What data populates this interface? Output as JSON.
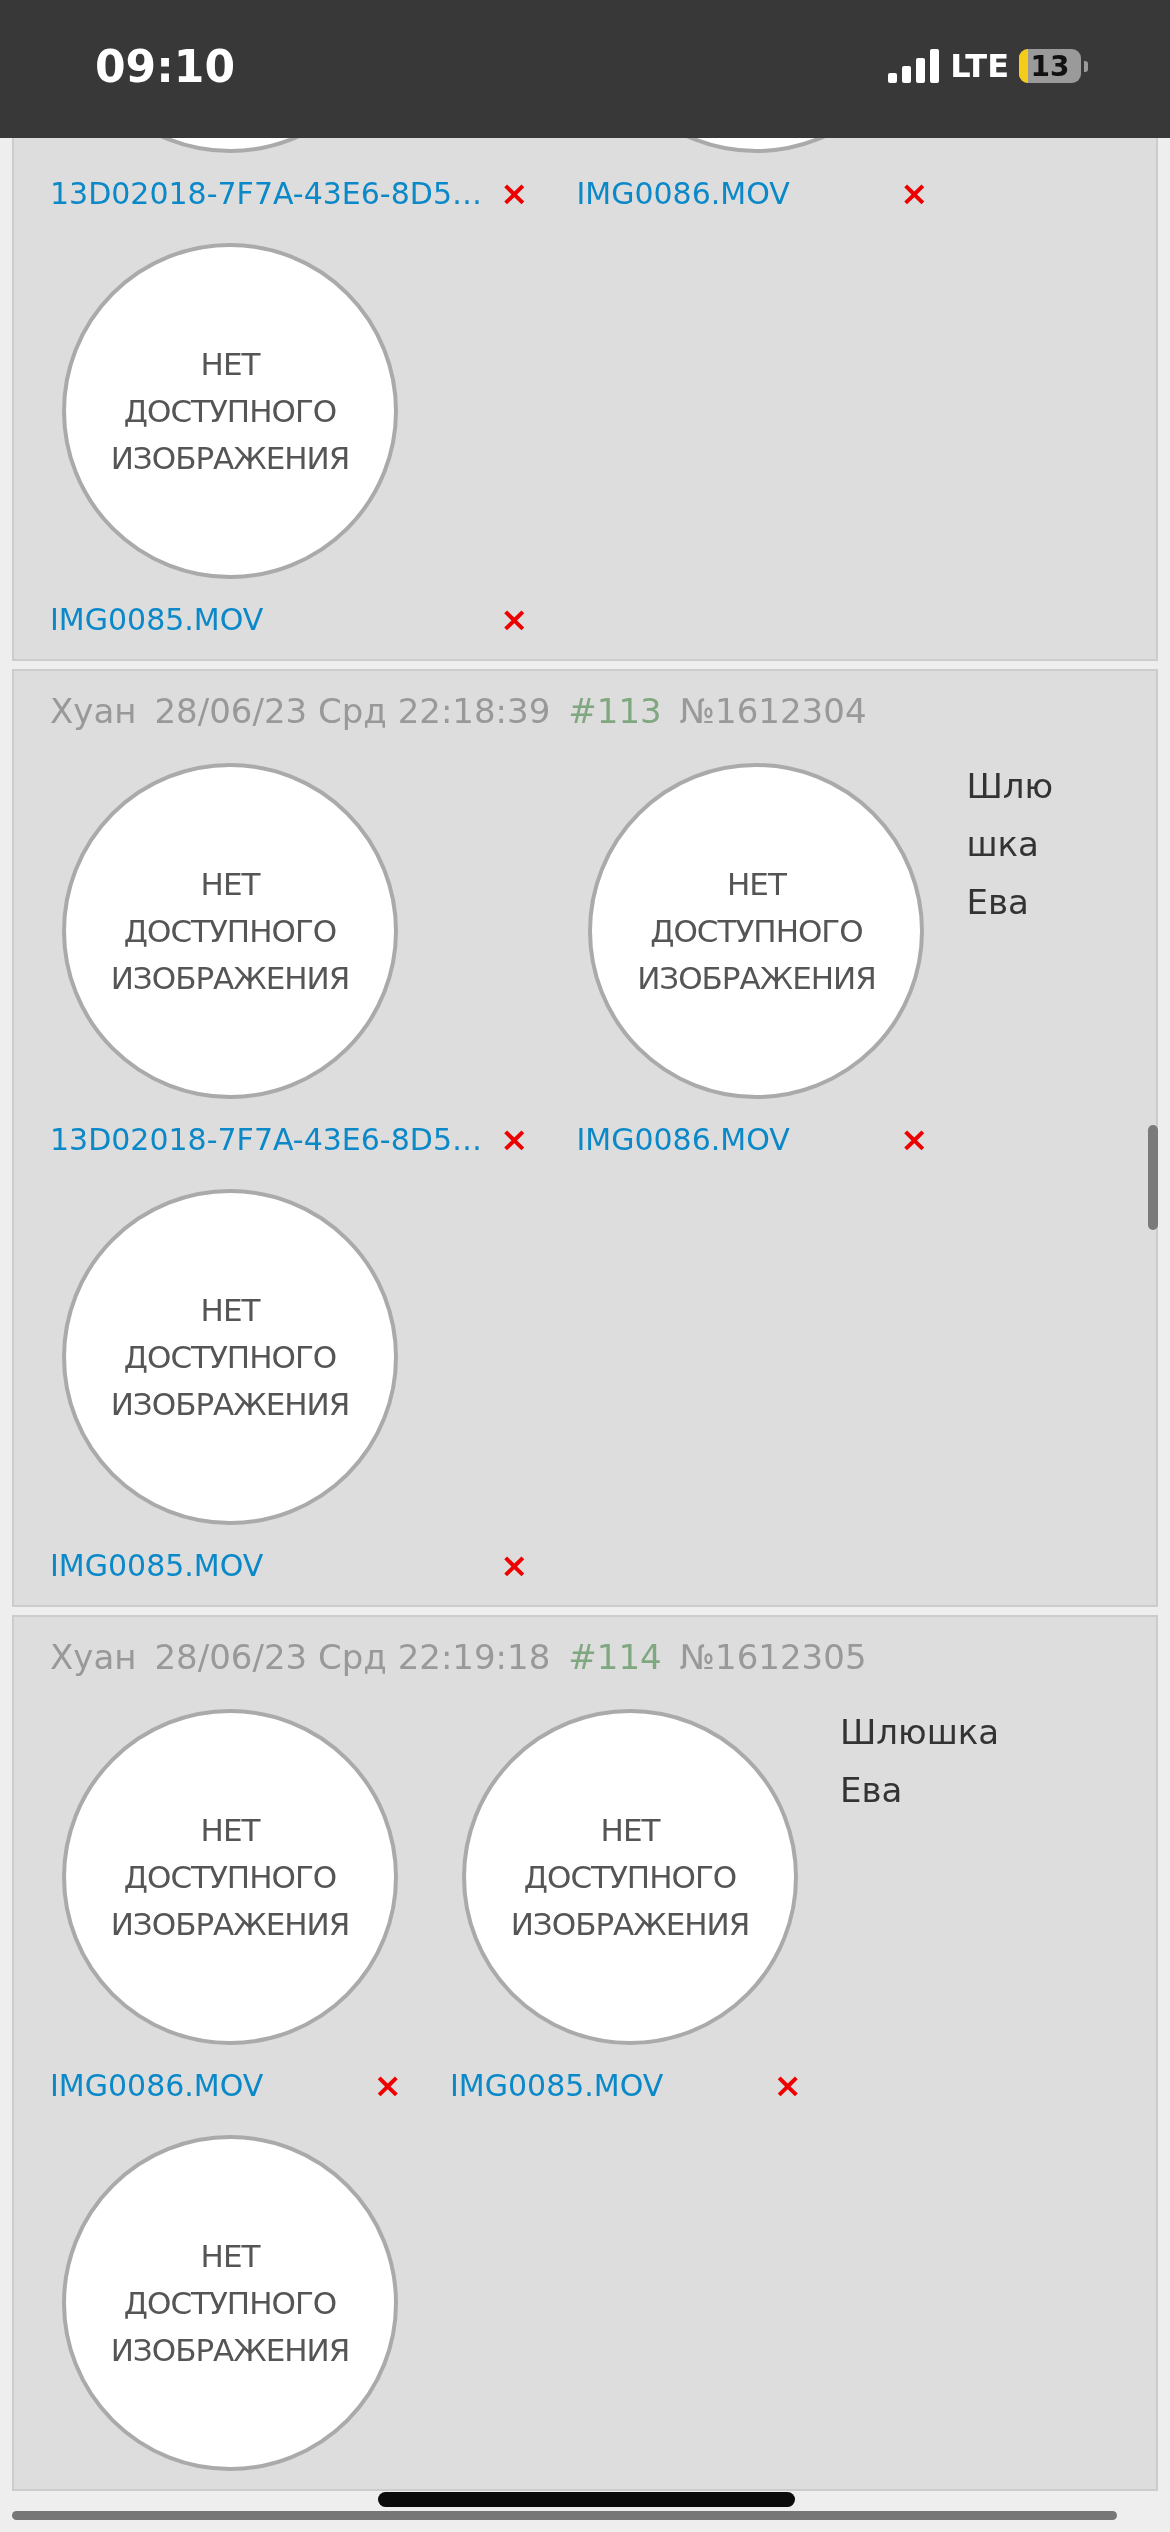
{
  "status_bar": {
    "time": "09:10",
    "network": "LTE",
    "battery": "13"
  },
  "posts": [
    {
      "files": [
        {
          "name": "13D02018-7F7A-43E6-8D5…",
          "remove": "×"
        },
        {
          "name": "IMG0086.MOV",
          "remove": "×"
        },
        {
          "name": "IMG0085.MOV",
          "remove": "×",
          "thumb_text": "НЕТ ДОСТУПНОГО ИЗОБРАЖЕНИЯ"
        }
      ]
    },
    {
      "author": "Хуан",
      "date": "28/06/23 Срд 22:18:39",
      "index": "#113",
      "number": "№1612304",
      "comment": "Шлюшка Ева",
      "files": [
        {
          "name": "13D02018-7F7A-43E6-8D5…",
          "remove": "×",
          "thumb_text": "НЕТ ДОСТУПНОГО ИЗОБРАЖЕНИЯ"
        },
        {
          "name": "IMG0086.MOV",
          "remove": "×",
          "thumb_text": "НЕТ ДОСТУПНОГО ИЗОБРАЖЕНИЯ"
        },
        {
          "name": "IMG0085.MOV",
          "remove": "×",
          "thumb_text": "НЕТ ДОСТУПНОГО ИЗОБРАЖЕНИЯ"
        }
      ]
    },
    {
      "author": "Хуан",
      "date": "28/06/23 Срд 22:19:18",
      "index": "#114",
      "number": "№1612305",
      "comment": "Шлюшка Ева",
      "files": [
        {
          "name": "IMG0086.MOV",
          "remove": "×",
          "thumb_text": "НЕТ ДОСТУПНОГО ИЗОБРАЖЕНИЯ"
        },
        {
          "name": "IMG0085.MOV",
          "remove": "×",
          "thumb_text": "НЕТ ДОСТУПНОГО ИЗОБРАЖЕНИЯ"
        },
        {
          "thumb_text": "НЕТ ДОСТУПНОГО ИЗОБРАЖЕНИЯ"
        }
      ]
    }
  ]
}
